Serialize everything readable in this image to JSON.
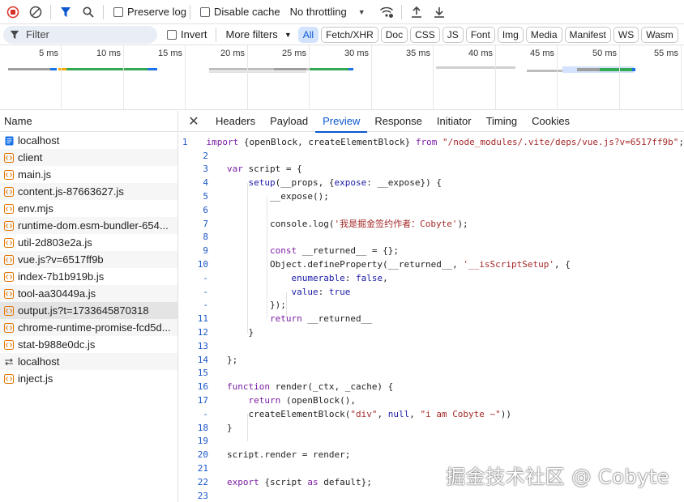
{
  "toolbar": {
    "preserve_log": "Preserve log",
    "disable_cache": "Disable cache",
    "throttling": "No throttling"
  },
  "filterbar": {
    "filter_placeholder": "Filter",
    "invert": "Invert",
    "more_filters": "More filters",
    "chips": [
      "All",
      "Fetch/XHR",
      "Doc",
      "CSS",
      "JS",
      "Font",
      "Img",
      "Media",
      "Manifest",
      "WS",
      "Wasm"
    ],
    "active_chip": "All"
  },
  "timeline": {
    "ticks": [
      "5 ms",
      "10 ms",
      "15 ms",
      "20 ms",
      "25 ms",
      "30 ms",
      "35 ms",
      "40 ms",
      "45 ms",
      "50 ms",
      "55 ms"
    ]
  },
  "requests": {
    "header": "Name",
    "items": [
      {
        "name": "localhost",
        "type": "doc"
      },
      {
        "name": "client",
        "type": "script"
      },
      {
        "name": "main.js",
        "type": "script"
      },
      {
        "name": "content.js-87663627.js",
        "type": "script"
      },
      {
        "name": "env.mjs",
        "type": "script"
      },
      {
        "name": "runtime-dom.esm-bundler-654...",
        "type": "script"
      },
      {
        "name": "util-2d803e2a.js",
        "type": "script"
      },
      {
        "name": "vue.js?v=6517ff9b",
        "type": "script"
      },
      {
        "name": "index-7b1b919b.js",
        "type": "script"
      },
      {
        "name": "tool-aa30449a.js",
        "type": "script"
      },
      {
        "name": "output.js?t=1733645870318",
        "type": "script"
      },
      {
        "name": "chrome-runtime-promise-fcd5d...",
        "type": "script"
      },
      {
        "name": "stat-b988e0dc.js",
        "type": "script"
      },
      {
        "name": "localhost",
        "type": "redirect"
      },
      {
        "name": "inject.js",
        "type": "script"
      }
    ]
  },
  "detail_tabs": [
    "Headers",
    "Payload",
    "Preview",
    "Response",
    "Initiator",
    "Timing",
    "Cookies"
  ],
  "active_tab": "Preview",
  "code_lines": [
    {
      "n": "1",
      "text": "import {openBlock, createElementBlock} from \"/node_modules/.vite/deps/vue.js?v=6517ff9b\";"
    },
    {
      "n": "2",
      "text": ""
    },
    {
      "n": "3",
      "text": "var script = {"
    },
    {
      "n": "4",
      "text": "    setup(__props, {expose: __expose}) {"
    },
    {
      "n": "5",
      "text": "        __expose();"
    },
    {
      "n": "6",
      "text": ""
    },
    {
      "n": "7",
      "text": "        console.log('我是掘金签约作者：Cobyte');"
    },
    {
      "n": "8",
      "text": ""
    },
    {
      "n": "9",
      "text": "        const __returned__ = {};"
    },
    {
      "n": "10",
      "text": "        Object.defineProperty(__returned__, '__isScriptSetup', {"
    },
    {
      "n": "-",
      "text": "            enumerable: false,"
    },
    {
      "n": "-",
      "text": "            value: true"
    },
    {
      "n": "-",
      "text": "        });"
    },
    {
      "n": "11",
      "text": "        return __returned__"
    },
    {
      "n": "12",
      "text": "    }"
    },
    {
      "n": "13",
      "text": ""
    },
    {
      "n": "14",
      "text": "};"
    },
    {
      "n": "15",
      "text": ""
    },
    {
      "n": "16",
      "text": "function render(_ctx, _cache) {"
    },
    {
      "n": "17",
      "text": "    return (openBlock(),"
    },
    {
      "n": "-",
      "text": "    createElementBlock(\"div\", null, \"i am Cobyte ~\"))"
    },
    {
      "n": "18",
      "text": "}"
    },
    {
      "n": "19",
      "text": ""
    },
    {
      "n": "20",
      "text": "script.render = render;"
    },
    {
      "n": "21",
      "text": ""
    },
    {
      "n": "22",
      "text": "export {script as default};"
    },
    {
      "n": "23",
      "text": ""
    }
  ],
  "watermark": "掘金技术社区 @ Cobyte",
  "colors": {
    "accent": "#0b57d0",
    "record_red": "#d93025",
    "keyword": "#7b1fa2",
    "string": "#a52a2a"
  }
}
